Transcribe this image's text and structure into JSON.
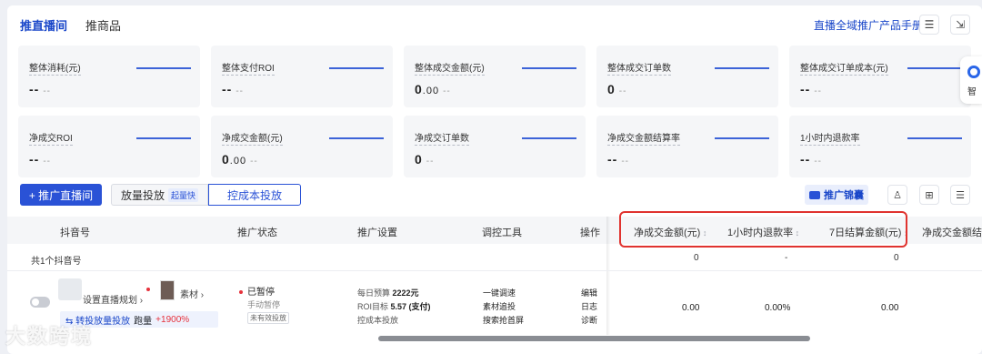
{
  "header": {
    "tabs": [
      "推直播间",
      "推商品"
    ],
    "manual_link": "直播全域推广产品手册"
  },
  "metrics_row1": [
    {
      "label": "整体消耗(元)",
      "value": "--",
      "sub": "--"
    },
    {
      "label": "整体支付ROI",
      "value": "--",
      "sub": "--"
    },
    {
      "label": "整体成交金额(元)",
      "value": "0",
      "decimal": ".00",
      "sub": "--"
    },
    {
      "label": "整体成交订单数",
      "value": "0",
      "sub": "--"
    },
    {
      "label": "整体成交订单成本(元)",
      "value": "--",
      "sub": "--"
    }
  ],
  "metrics_row2": [
    {
      "label": "净成交ROI",
      "value": "--",
      "sub": "--"
    },
    {
      "label": "净成交金额(元)",
      "value": "0",
      "decimal": ".00",
      "sub": "--"
    },
    {
      "label": "净成交订单数",
      "value": "0",
      "sub": "--"
    },
    {
      "label": "净成交金额结算率",
      "value": "--",
      "sub": "--"
    },
    {
      "label": "1小时内退款率",
      "value": "--",
      "sub": "--"
    }
  ],
  "side_widget": {
    "text": "智"
  },
  "actions": {
    "primary": "+ 推广直播间",
    "seg_option1": "放量投放",
    "seg_option1_badge": "起量快",
    "seg_option2": "控成本投放",
    "bag_button": "推广锦囊"
  },
  "table": {
    "headers": [
      "抖音号",
      "推广状态",
      "推广设置",
      "调控工具",
      "操作",
      "净成交金额(元)",
      "1小时内退款率",
      "7日结算金额(元)",
      "净成交金额结"
    ],
    "summary_label": "共1个抖音号",
    "summary_values": [
      "0",
      "-",
      "0"
    ],
    "row": {
      "plan_link": "设置直播规划",
      "material_link": "素材",
      "switch_link": "转投放量投放",
      "switch_text": "跑量",
      "switch_pct": "+1900%",
      "status": "已暂停",
      "status_sub": "手动暂停",
      "status_tag": "未有效投放",
      "budget_label": "每日预算",
      "budget_value": "2222元",
      "roi_label": "ROI目标",
      "roi_value": "5.57 (支付)",
      "control_text": "控成本投放",
      "tools": [
        "一键调速",
        "素材追投",
        "搜索抢首屏"
      ],
      "ops": [
        "编辑",
        "日志",
        "诊断"
      ],
      "net_amount": "0.00",
      "refund_rate": "0.00%",
      "settle_amount": "0.00"
    }
  },
  "watermark": "大数跨境",
  "colors": {
    "accent": "#2a52d6",
    "highlight": "#e0332f",
    "danger": "#e6323c"
  }
}
